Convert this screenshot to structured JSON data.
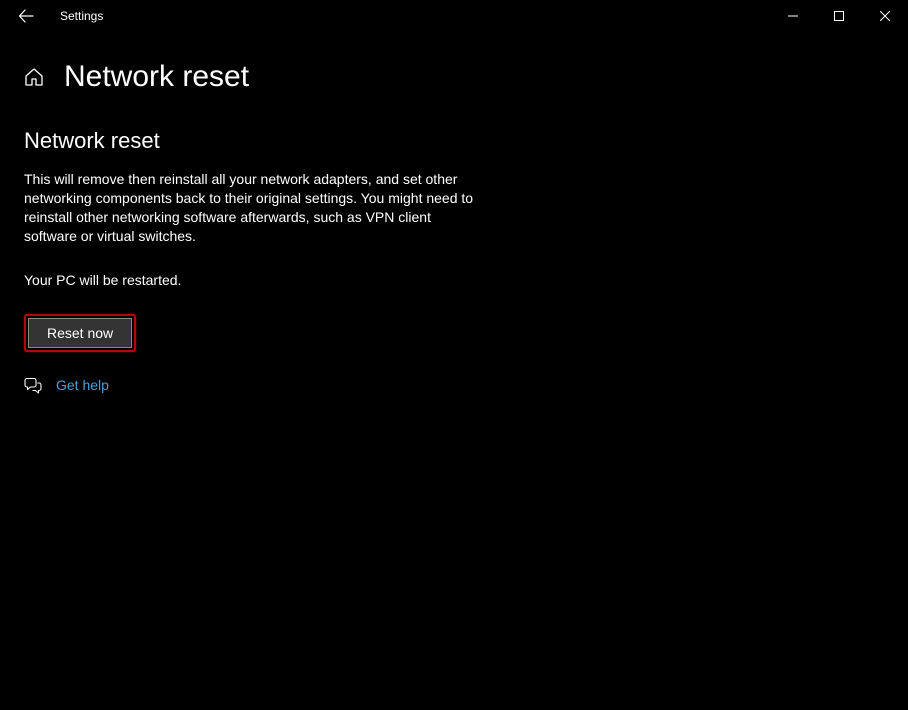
{
  "titlebar": {
    "app_name": "Settings"
  },
  "header": {
    "page_title": "Network reset"
  },
  "main": {
    "section_heading": "Network reset",
    "description": "This will remove then reinstall all your network adapters, and set other networking components back to their original settings. You might need to reinstall other networking software afterwards, such as VPN client software or virtual switches.",
    "restart_note": "Your PC will be restarted.",
    "reset_button_label": "Reset now",
    "help_link_label": "Get help"
  }
}
